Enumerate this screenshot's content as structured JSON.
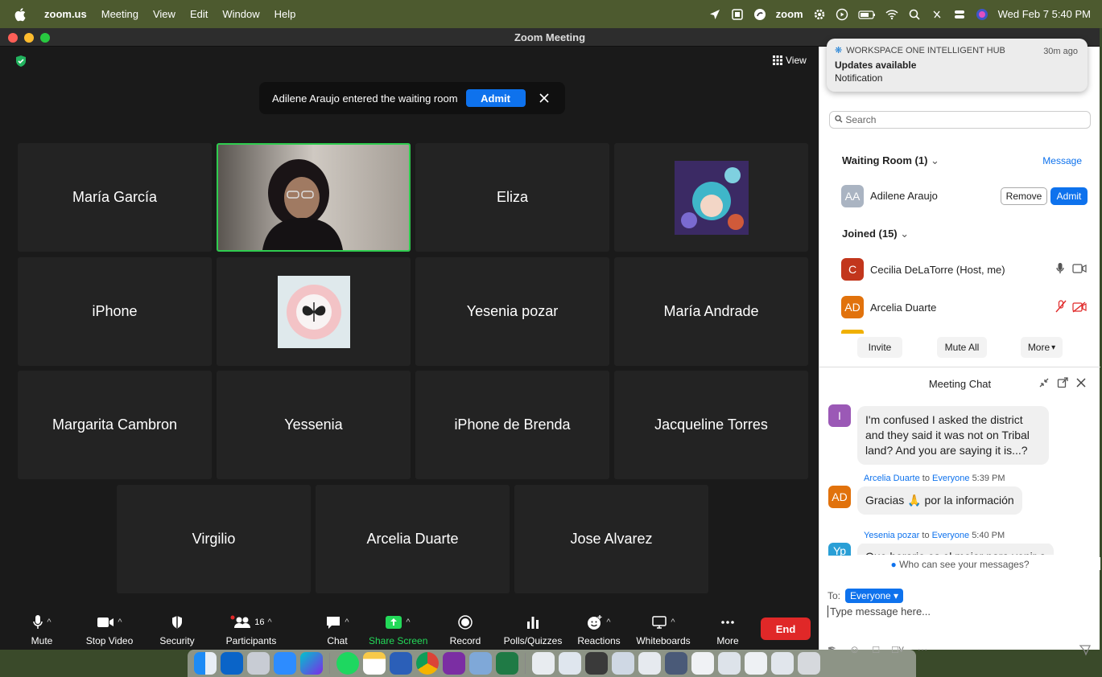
{
  "menubar": {
    "items": [
      "zoom.us",
      "Meeting",
      "View",
      "Edit",
      "Window",
      "Help"
    ],
    "zoom_status": "zoom",
    "datetime": "Wed Feb 7  5:40 PM"
  },
  "window": {
    "title": "Zoom Meeting"
  },
  "video": {
    "view_label": "View",
    "notification": {
      "text": "Adilene Araujo entered the waiting room",
      "admit_label": "Admit"
    },
    "tiles": [
      {
        "name": "María García"
      },
      {
        "name": ""
      },
      {
        "name": "Eliza"
      },
      {
        "name": ""
      },
      {
        "name": "iPhone"
      },
      {
        "name": ""
      },
      {
        "name": "Yesenia pozar"
      },
      {
        "name": "María Andrade"
      },
      {
        "name": "Margarita Cambron"
      },
      {
        "name": "Yessenia"
      },
      {
        "name": "iPhone de Brenda"
      },
      {
        "name": "Jacqueline Torres"
      },
      {
        "name": "Virgilio"
      },
      {
        "name": "Arcelia Duarte"
      },
      {
        "name": "Jose Alvarez"
      }
    ]
  },
  "toolbar": {
    "mute": "Mute",
    "stop_video": "Stop Video",
    "security": "Security",
    "participants": "Participants",
    "participants_count": "16",
    "chat": "Chat",
    "share_screen": "Share Screen",
    "record": "Record",
    "polls": "Polls/Quizzes",
    "reactions": "Reactions",
    "whiteboards": "Whiteboards",
    "more": "More",
    "end": "End"
  },
  "system_notification": {
    "app": "WORKSPACE ONE INTELLIGENT HUB",
    "ago": "30m ago",
    "title": "Updates available",
    "body": "Notification"
  },
  "participants_panel": {
    "search_placeholder": "Search",
    "waiting_room_header": "Waiting Room (1)",
    "message_link": "Message",
    "waiting": {
      "initials": "AA",
      "name": "Adilene Araujo",
      "remove_label": "Remove",
      "admit_label": "Admit"
    },
    "joined_header": "Joined (15)",
    "joined": [
      {
        "initials": "C",
        "name": "Cecilia DeLaTorre (Host, me)",
        "color": "#c2361c"
      },
      {
        "initials": "AD",
        "name": "Arcelia Duarte",
        "color": "#e1720c"
      }
    ],
    "invite_label": "Invite",
    "mute_all_label": "Mute All",
    "more_label": "More"
  },
  "chat": {
    "title": "Meeting Chat",
    "messages": [
      {
        "initials": "I",
        "sender": "",
        "to": "",
        "time": "",
        "text": "I'm confused I asked the district and they said it was not on Tribal land? And you are saying it is...?"
      },
      {
        "initials": "AD",
        "sender": "Arcelia Duarte",
        "to_word": "to",
        "to": "Everyone",
        "time": "5:39 PM",
        "text": "Gracias 🙏 por la información"
      },
      {
        "initials": "Yp",
        "sender": "Yesenia pozar",
        "to_word": "to",
        "to": "Everyone",
        "time": "5:40 PM",
        "text": "Que horario es el mejor para venir a"
      }
    ],
    "who_can_see": "Who can see your messages?",
    "to_label": "To:",
    "to_value": "Everyone",
    "input_placeholder": "Type message here..."
  }
}
